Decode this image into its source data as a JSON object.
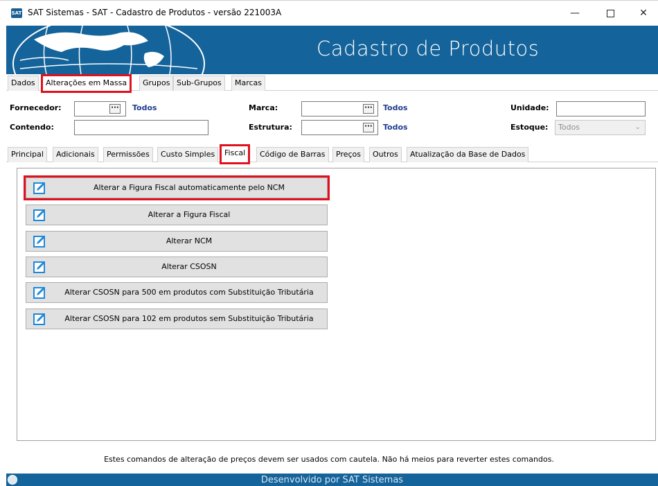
{
  "window": {
    "title": "SAT Sistemas - SAT - Cadastro de Produtos - versão 221003A",
    "icon_text": "SAT",
    "controls": {
      "minimize": "—",
      "close": "✕"
    }
  },
  "banner": {
    "title": "Cadastro de Produtos"
  },
  "top_tabs": [
    "Dados",
    "Alterações em Massa",
    "Grupos",
    "Sub-Grupos",
    "Marcas"
  ],
  "top_tabs_active": "Alterações em Massa",
  "filters": {
    "fornecedor_label": "Fornecedor:",
    "fornecedor_value": "Todos",
    "contendo_label": "Contendo:",
    "marca_label": "Marca:",
    "marca_value": "Todos",
    "estrutura_label": "Estrutura:",
    "estrutura_value": "Todos",
    "unidade_label": "Unidade:",
    "estoque_label": "Estoque:",
    "estoque_value": "Todos",
    "dots": "···"
  },
  "sub_tabs": [
    "Principal",
    "Adicionais",
    "Permissões",
    "Custo Simples",
    "Fiscal",
    "Código de Barras",
    "Preços",
    "Outros",
    "Atualização da Base de Dados"
  ],
  "sub_tabs_active": "Fiscal",
  "commands": [
    "Alterar a Figura Fiscal automaticamente pelo NCM",
    "Alterar a Figura Fiscal",
    "Alterar NCM",
    "Alterar CSOSN",
    "Alterar CSOSN para 500 em produtos com Substituição Tributária",
    "Alterar CSOSN para 102 em produtos sem Substituição Tributária"
  ],
  "footer": {
    "note": "Estes comandos de alteração de preços devem ser usados com cautela. Não há meios para reverter estes comandos.",
    "status": "Desenvolvido por SAT Sistemas"
  },
  "colors": {
    "banner": "#14639a",
    "highlight": "#e0101e",
    "todos": "#1f3c8f"
  }
}
